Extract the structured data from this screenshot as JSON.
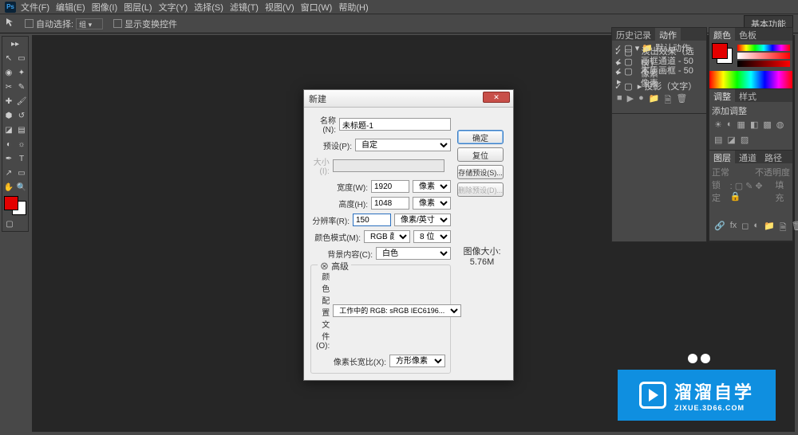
{
  "menubar": [
    "文件(F)",
    "编辑(E)",
    "图像(I)",
    "图层(L)",
    "文字(Y)",
    "选择(S)",
    "滤镜(T)",
    "视图(V)",
    "窗口(W)",
    "帮助(H)"
  ],
  "optbar": {
    "autoSelect": "自动选择:",
    "showControls": "显示变换控件",
    "basic": "基本功能"
  },
  "dialog": {
    "title": "新建",
    "nameLabel": "名称(N):",
    "nameValue": "未标题-1",
    "presetLabel": "预设(P):",
    "presetValue": "自定",
    "sizeLabel": "大小(I):",
    "widthLabel": "宽度(W):",
    "widthValue": "1920",
    "widthUnit": "像素",
    "heightLabel": "高度(H):",
    "heightValue": "1048",
    "heightUnit": "像素",
    "resLabel": "分辨率(R):",
    "resValue": "150",
    "resUnit": "像素/英寸",
    "colorModeLabel": "颜色模式(M):",
    "colorModeValue": "RGB 颜色",
    "bitDepth": "8 位",
    "bgLabel": "背景内容(C):",
    "bgValue": "白色",
    "okBtn": "确定",
    "cancelBtn": "复位",
    "savePresetBtn": "存储预设(S)...",
    "deletePresetBtn": "删除预设(D)...",
    "imageSizeLabel": "图像大小:",
    "imageSizeValue": "5.76M",
    "advanced": "高级",
    "profileLabel": "颜色配置文件(O):",
    "profileValue": "工作中的 RGB: sRGB IEC6196...",
    "aspectLabel": "像素长宽比(X):",
    "aspectValue": "方形像素"
  },
  "panels": {
    "history": "历史记录",
    "actions": "动作",
    "defaultActions": "默认动作",
    "action1": "淡出效果（选区）",
    "action2": "画框通道 - 50 像素",
    "action3": "木质画框 - 50 像素",
    "action4": "投影（文字）",
    "color": "颜色",
    "swatches": "色板",
    "adjust": "调整",
    "styles": "样式",
    "addAdjust": "添加调整",
    "layers": "图层",
    "channels": "通道",
    "paths": "路径",
    "normal": "正常",
    "opacity": "不透明度",
    "lock": "锁定",
    "fill": "填充"
  },
  "watermark": {
    "cn": "溜溜自学",
    "en": "ZIXUE.3D66.COM"
  }
}
